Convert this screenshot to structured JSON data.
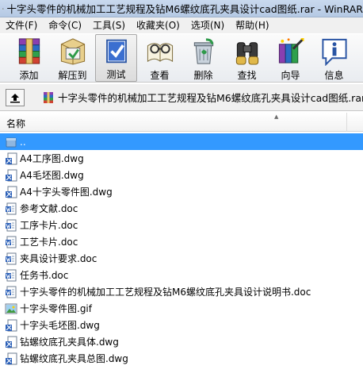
{
  "window": {
    "title": "十字头零件的机械加工工艺规程及钻M6螺纹底孔夹具设计cad图纸.rar - WinRAR"
  },
  "menu": [
    "文件(F)",
    "命令(C)",
    "工具(S)",
    "收藏夹(O)",
    "选项(N)",
    "帮助(H)"
  ],
  "toolbar": [
    {
      "label": "添加",
      "icon": "add-archive-icon"
    },
    {
      "label": "解压到",
      "icon": "extract-to-icon"
    },
    {
      "label": "测试",
      "icon": "test-icon"
    },
    {
      "label": "查看",
      "icon": "view-icon"
    },
    {
      "label": "删除",
      "icon": "delete-icon"
    },
    {
      "label": "查找",
      "icon": "find-icon"
    },
    {
      "label": "向导",
      "icon": "wizard-icon"
    },
    {
      "label": "信息",
      "icon": "info-icon"
    }
  ],
  "address": {
    "path": "十字头零件的机械加工工艺规程及钻M6螺纹底孔夹具设计cad图纸.rar\\"
  },
  "columns": {
    "name": "名称"
  },
  "files": [
    {
      "name": "..",
      "type": "parent"
    },
    {
      "name": "A4工序图.dwg",
      "type": "dwg"
    },
    {
      "name": "A4毛坯图.dwg",
      "type": "dwg"
    },
    {
      "name": "A4十字头零件图.dwg",
      "type": "dwg"
    },
    {
      "name": "参考文献.doc",
      "type": "doc"
    },
    {
      "name": "工序卡片.doc",
      "type": "doc"
    },
    {
      "name": "工艺卡片.doc",
      "type": "doc"
    },
    {
      "name": "夹具设计要求.doc",
      "type": "doc"
    },
    {
      "name": "任务书.doc",
      "type": "doc"
    },
    {
      "name": "十字头零件的机械加工工艺规程及钻M6螺纹底孔夹具设计说明书.doc",
      "type": "doc"
    },
    {
      "name": "十字头零件图.gif",
      "type": "gif"
    },
    {
      "name": "十字头毛坯图.dwg",
      "type": "dwg"
    },
    {
      "name": "钻螺纹底孔夹具体.dwg",
      "type": "dwg"
    },
    {
      "name": "钻螺纹底孔夹具总图.dwg",
      "type": "dwg"
    }
  ],
  "colors": {
    "selection": "#3399ff",
    "titlebar": "#b9cde7"
  }
}
